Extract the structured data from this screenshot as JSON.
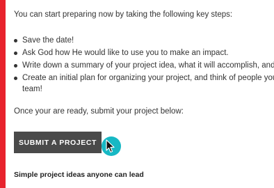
{
  "intro_text": "You can start preparing now by taking the following key steps:",
  "steps": [
    {
      "text": "Save the date!"
    },
    {
      "text": "Ask God how He would like to use you to make an impact."
    },
    {
      "text": "Write down a summary of your project idea, what it will accomplish, and w"
    },
    {
      "text": "Create an initial plan for organizing your project, and think of people you l",
      "continuation": "team!"
    }
  ],
  "outro_text": "Once your are ready, submit your project below:",
  "submit_button_label": "SUBMIT A PROJECT",
  "subheading": "Simple project ideas anyone can lead",
  "icons": {
    "cursor": "mouse-pointer-icon",
    "bullet": "bullet-dot"
  },
  "colors": {
    "page_border": "#e8232d",
    "button_bg": "#4a4a4a",
    "cursor_highlight": "#17b8c4"
  }
}
